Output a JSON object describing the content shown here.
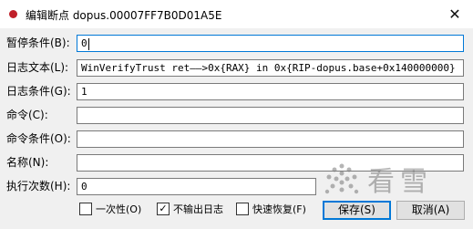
{
  "window": {
    "title": "编辑断点 dopus.00007FF7B0D01A5E",
    "icon": "red-dot-icon",
    "close_glyph": "✕"
  },
  "fields": [
    {
      "key": "pause_condition",
      "label": "暂停条件(B):",
      "value": "0"
    },
    {
      "key": "log_text",
      "label": "日志文本(L):",
      "value": "WinVerifyTrust ret——>0x{RAX} in 0x{RIP-dopus.base+0x140000000}"
    },
    {
      "key": "log_condition",
      "label": "日志条件(G):",
      "value": "1"
    },
    {
      "key": "command",
      "label": "命令(C):",
      "value": ""
    },
    {
      "key": "command_condition",
      "label": "命令条件(O):",
      "value": ""
    },
    {
      "key": "name",
      "label": "名称(N):",
      "value": ""
    },
    {
      "key": "hit_count",
      "label": "执行次数(H):",
      "value": "0"
    }
  ],
  "checkboxes": [
    {
      "label": "一次性(O)",
      "checked": false
    },
    {
      "label": "不输出日志",
      "checked": true
    },
    {
      "label": "快速恢复(F)",
      "checked": false
    }
  ],
  "buttons": {
    "save": "保存(S)",
    "cancel": "取消(A)"
  },
  "watermark": {
    "text": "看雪",
    "icon": "snowflake-logo"
  },
  "colors": {
    "focus_border": "#0078d7",
    "title_icon": "#c0202a"
  }
}
